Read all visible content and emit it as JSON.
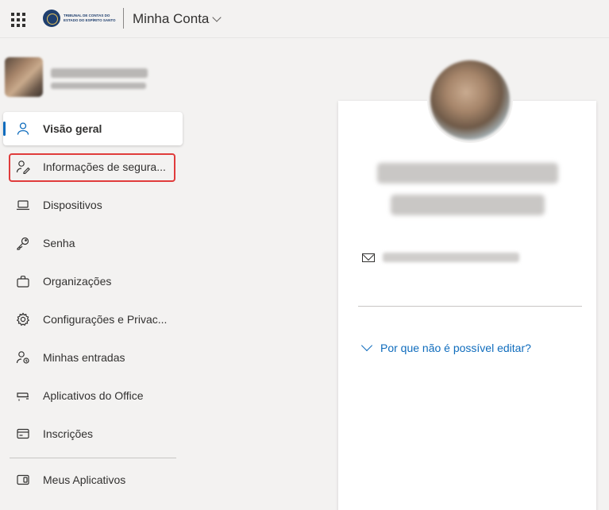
{
  "header": {
    "app_title": "Minha Conta",
    "logo_text_line1": "TRIBUNAL DE CONTAS DO",
    "logo_text_line2": "ESTADO DO ESPÍRITO SANTO",
    "icons": [
      "app-launcher-icon",
      "chevron-down-icon"
    ]
  },
  "nav": {
    "items": [
      {
        "label": "Visão geral",
        "icon": "person-icon",
        "active": true
      },
      {
        "label": "Informações de segura...",
        "icon": "security-info-icon",
        "highlighted": true
      },
      {
        "label": "Dispositivos",
        "icon": "laptop-icon"
      },
      {
        "label": "Senha",
        "icon": "key-icon"
      },
      {
        "label": "Organizações",
        "icon": "briefcase-icon"
      },
      {
        "label": "Configurações e Privac...",
        "icon": "gear-icon"
      },
      {
        "label": "Minhas entradas",
        "icon": "sign-ins-icon"
      },
      {
        "label": "Aplicativos do Office",
        "icon": "office-apps-icon"
      },
      {
        "label": "Inscrições",
        "icon": "subscriptions-icon"
      },
      {
        "label": "Meus Aplicativos",
        "icon": "my-apps-icon"
      }
    ]
  },
  "profile_card": {
    "why_cant_edit": "Por que não é possível editar?"
  },
  "colors": {
    "accent": "#0f6cbd",
    "highlight_border": "#e03c3c",
    "background": "#f3f2f1"
  }
}
